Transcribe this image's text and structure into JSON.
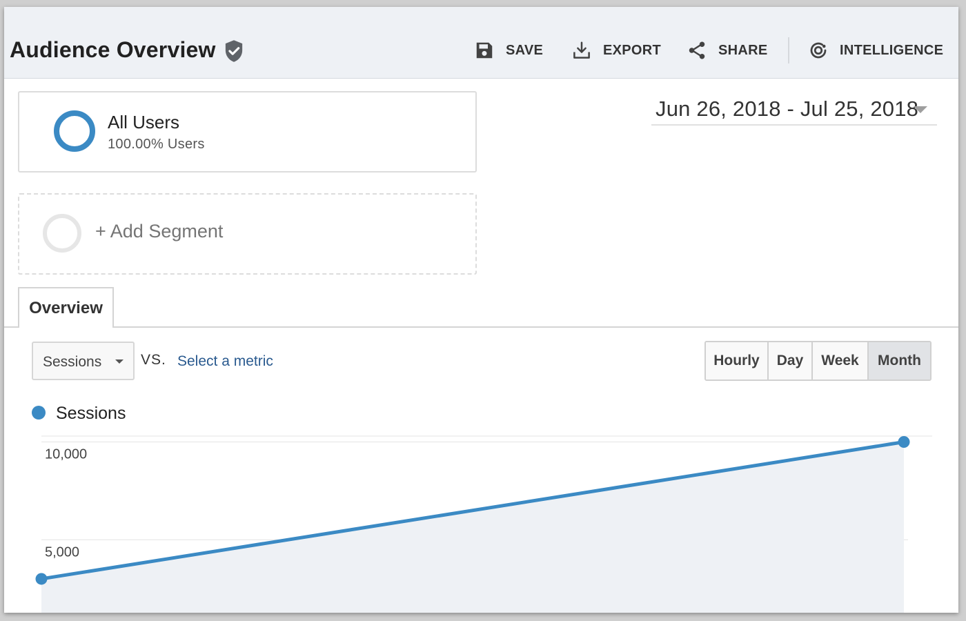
{
  "header": {
    "title": "Audience Overview",
    "toolbar": {
      "save": "SAVE",
      "export": "EXPORT",
      "share": "SHARE",
      "intelligence": "INTELLIGENCE"
    }
  },
  "segments": {
    "active": {
      "name": "All Users",
      "subtitle": "100.00% Users"
    },
    "add_label": "+ Add Segment"
  },
  "date_range": "Jun 26, 2018 - Jul 25, 2018",
  "tabs": [
    {
      "label": "Overview",
      "active": true
    }
  ],
  "metric_controls": {
    "metric": "Sessions",
    "vs": "VS.",
    "select_metric": "Select a metric"
  },
  "granularity": {
    "options": [
      "Hourly",
      "Day",
      "Week",
      "Month"
    ],
    "selected": "Month"
  },
  "legend": {
    "label": "Sessions"
  },
  "colors": {
    "accent": "#3b8ac4",
    "link": "#2a5a8f",
    "chart_fill": "#eef1f5",
    "header_bg": "#eef1f5"
  },
  "chart_data": {
    "type": "area",
    "series": [
      {
        "name": "Sessions",
        "values": [
          3000,
          10000
        ]
      }
    ],
    "yticks": [
      "10,000",
      "5,000"
    ],
    "ytick_values": [
      10000,
      5000
    ],
    "ylim": [
      0,
      10300
    ],
    "grid": true
  }
}
